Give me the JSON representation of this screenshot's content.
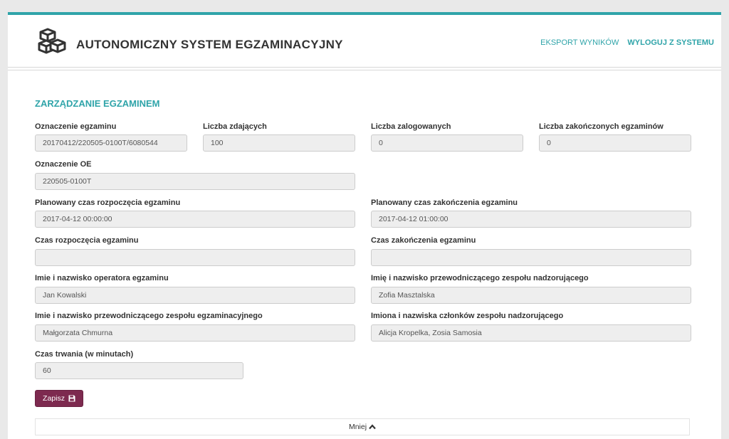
{
  "header": {
    "title": "AUTONOMICZNY SYSTEM EGZAMINACYJNY",
    "nav": {
      "export": "EKSPORT WYNIKÓW",
      "logout": "WYLOGUJ Z SYSTEMU"
    },
    "logo_icon": "cubes-icon"
  },
  "section_title": "ZARZĄDZANIE EGZAMINEM",
  "fields": {
    "exam_id": {
      "label": "Oznaczenie egzaminu",
      "value": "20170412/220505-0100T/6080544"
    },
    "candidates": {
      "label": "Liczba zdających",
      "value": "100"
    },
    "logged_in": {
      "label": "Liczba zalogowanych",
      "value": "0"
    },
    "finished": {
      "label": "Liczba zakończonych egzaminów",
      "value": "0"
    },
    "oe": {
      "label": "Oznaczenie OE",
      "value": "220505-0100T"
    },
    "planned_start": {
      "label": "Planowany czas rozpoczęcia egzaminu",
      "value": "2017-04-12 00:00:00"
    },
    "planned_end": {
      "label": "Planowany czas zakończenia egzaminu",
      "value": "2017-04-12 01:00:00"
    },
    "start": {
      "label": "Czas rozpoczęcia egzaminu",
      "value": ""
    },
    "end": {
      "label": "Czas zakończenia egzaminu",
      "value": ""
    },
    "operator": {
      "label": "Imie i nazwisko operatora egzaminu",
      "value": "Jan Kowalski"
    },
    "supervising_chair": {
      "label": "Imię i nazwisko przewodniczącego zespołu nadzorującego",
      "value": "Zofia Masztalska"
    },
    "exam_chair": {
      "label": "Imie i nazwisko przewodniczącego zespołu egzaminacyjnego",
      "value": "Małgorzata Chmurna"
    },
    "supervising_members": {
      "label": "Imiona i nazwiska członków zespołu nadzorującego",
      "value": "Alicja Kropelka, Zosia Samosia"
    },
    "duration": {
      "label": "Czas trwania (w minutach)",
      "value": "60"
    }
  },
  "buttons": {
    "save": "Zapisz",
    "save_icon": "floppy-disk-icon",
    "less": "Mniej",
    "less_icon": "chevron-up-icon"
  },
  "colors": {
    "accent": "#2fa4a9",
    "save_button": "#7d2a4f",
    "field_bg": "#eeeeee"
  }
}
